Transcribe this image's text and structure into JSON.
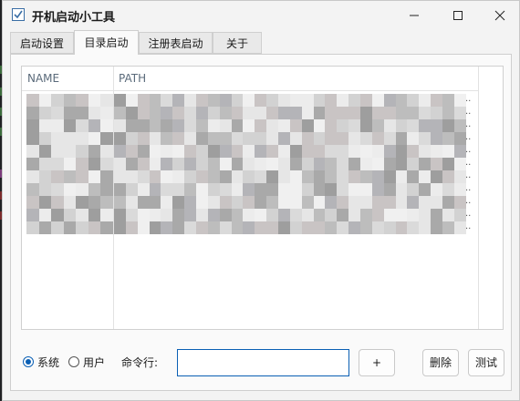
{
  "window": {
    "title": "开机启动小工具",
    "controls": {
      "minimize": "minimize",
      "maximize": "maximize",
      "close": "close"
    }
  },
  "tabs": [
    {
      "label": "启动设置",
      "active": false
    },
    {
      "label": "目录启动",
      "active": true
    },
    {
      "label": "注册表启动",
      "active": false
    },
    {
      "label": "关于",
      "active": false
    }
  ],
  "list": {
    "columns": {
      "name": "NAME",
      "path": "PATH"
    },
    "rows": [
      {
        "name": "",
        "path": ""
      },
      {
        "name": "",
        "path": ""
      },
      {
        "name": "",
        "path": ""
      },
      {
        "name": "",
        "path": ""
      },
      {
        "name": "",
        "path": ""
      },
      {
        "name": "",
        "path": ""
      },
      {
        "name": "",
        "path": ""
      },
      {
        "name": "",
        "path": ""
      },
      {
        "name": "",
        "path": ""
      },
      {
        "name": "",
        "path": ""
      },
      {
        "name": "",
        "path": ""
      }
    ],
    "truncation": ".."
  },
  "bottom": {
    "scope_options": [
      {
        "label": "系统",
        "selected": true
      },
      {
        "label": "用户",
        "selected": false
      }
    ],
    "command_label": "命令行:",
    "command_value": "",
    "add_label": "+",
    "delete_label": "删除",
    "test_label": "测试"
  },
  "colors": {
    "accent": "#0a5fb4",
    "window_bg": "#f3f3f3"
  }
}
